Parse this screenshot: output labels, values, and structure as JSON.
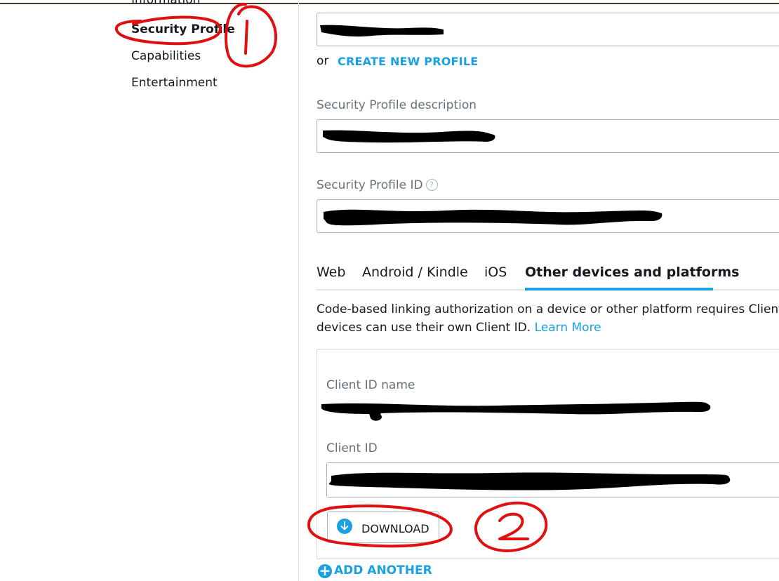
{
  "nav": {
    "items": [
      {
        "label": "Information"
      },
      {
        "label": "Security Profile"
      },
      {
        "label": "Capabilities"
      },
      {
        "label": "Entertainment"
      }
    ]
  },
  "form": {
    "or_text": "or",
    "create_new_profile": "CREATE NEW PROFILE",
    "description_label": "Security Profile description",
    "id_label": "Security Profile ID",
    "help_glyph": "?"
  },
  "tabs": [
    {
      "label": "Web"
    },
    {
      "label": "Android / Kindle"
    },
    {
      "label": "iOS"
    },
    {
      "label": "Other devices and platforms",
      "active": true
    }
  ],
  "description": {
    "line1": "Code-based linking authorization on a device or other platform requires Client IDs t",
    "line2_prefix": "devices can use their own Client ID.",
    "learn_more": "Learn More"
  },
  "client": {
    "name_label": "Client ID name",
    "id_label": "Client ID",
    "download_label": "DOWNLOAD",
    "add_another": "ADD ANOTHER",
    "add_glyph": "+"
  },
  "colors": {
    "accent": "#1ba1e2",
    "annotation": "#e01010",
    "redaction": "#000000"
  }
}
